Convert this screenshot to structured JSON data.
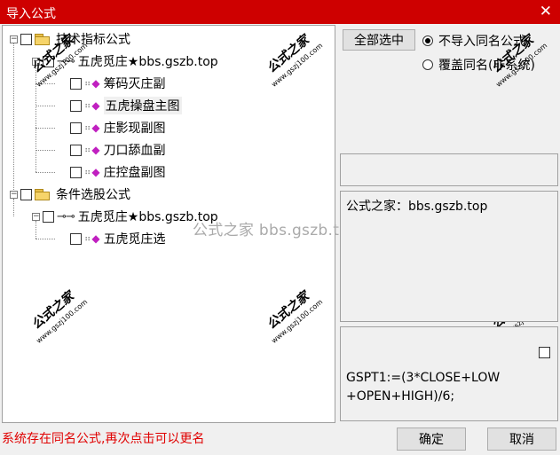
{
  "window": {
    "title": "导入公式",
    "close_icon": "close-icon"
  },
  "tree": {
    "groups": [
      {
        "label": "技术指标公式",
        "formula": {
          "label": "五虎觅庄★bbs.gszb.top"
        },
        "items": [
          "筹码灭庄副",
          "五虎操盘主图",
          "庄影现副图",
          "刀口舔血副",
          "庄控盘副图"
        ]
      },
      {
        "label": "条件选股公式",
        "formula": {
          "label": "五虎觅庄★bbs.gszb.top"
        },
        "items": [
          "五虎觅庄选"
        ]
      }
    ],
    "selected_item": "五虎操盘主图"
  },
  "watermark": {
    "center_text": "公式之家 bbs.gszb.top",
    "stamp_title": "公式之家",
    "stamp_url": "www.gszj100.com"
  },
  "controls": {
    "select_all_label": "全部选中",
    "radio_options": [
      "不导入同名公式",
      "覆盖同名(非系统)"
    ],
    "selected_radio": 0
  },
  "info_panel": {
    "text": "公式之家：bbs.gszb.top"
  },
  "code_panel": {
    "code_line1": "GSPT1:=(3*CLOSE+LOW",
    "code_line2": "+OPEN+HIGH)/6;"
  },
  "status": {
    "message": "系统存在同名公式,再次点击可以更名"
  },
  "buttons": {
    "ok_label": "确定",
    "cancel_label": "取消"
  },
  "colors": {
    "titlebar": "#ce0000",
    "status_text": "#e00000",
    "gem": "#c020c0",
    "folder": "#f6d46a"
  }
}
